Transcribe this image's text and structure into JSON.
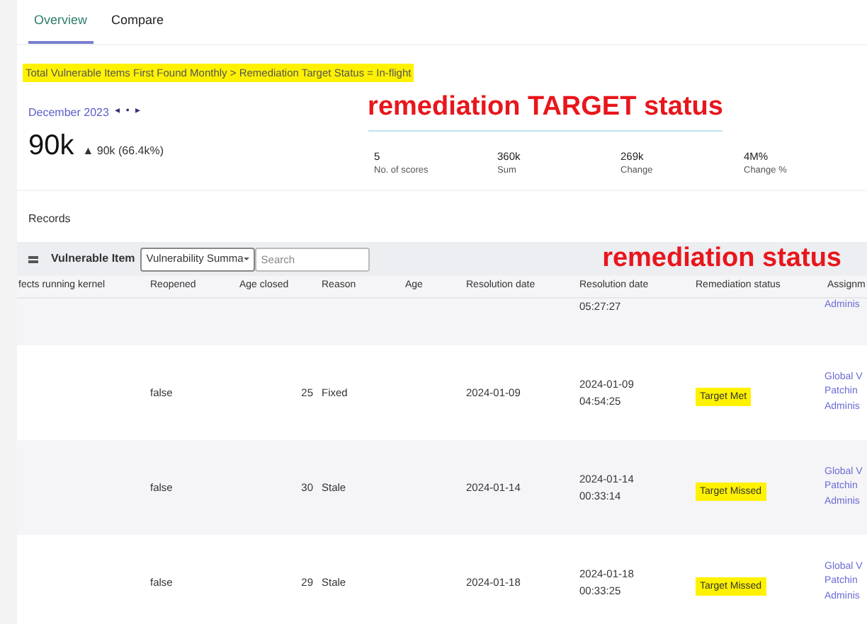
{
  "tabs": [
    {
      "label": "Overview",
      "selected": true
    },
    {
      "label": "Compare",
      "selected": false
    }
  ],
  "breadcrumb": {
    "text": "Total Vulnerable Items First Found Monthly > Remediation Target Status = In-flight",
    "highlighted": true
  },
  "period": {
    "label": "December 2023",
    "prev": "◂",
    "dot": "•",
    "next": "▸"
  },
  "kpi": {
    "value": "90k",
    "change": "▲ 90k (66.4k%)"
  },
  "stats": [
    {
      "value": "5",
      "label": "No. of scores"
    },
    {
      "value": "360k",
      "label": "Sum"
    },
    {
      "value": "269k",
      "label": "Change"
    },
    {
      "value": "4M%",
      "label": "Change %"
    }
  ],
  "annotations": [
    {
      "text": "remediation TARGET status",
      "underline": true
    },
    {
      "text": "remediation status",
      "underline": false
    }
  ],
  "records": {
    "title": "Records",
    "table_label": "Vulnerable Item",
    "select_value": "Vulnerability Summa",
    "search_placeholder": "Search"
  },
  "table": {
    "columns": [
      "fects running kernel",
      "Reopened",
      "Age closed",
      "Reason",
      "Age",
      "Resolution date",
      "Resolution date",
      "Remediation status",
      "Assignm"
    ],
    "partial_row": {
      "resolution_time": "05:27:27",
      "assignment": [
        "Adminis"
      ]
    },
    "rows": [
      {
        "reopened": "false",
        "age_closed": "25",
        "reason": "Fixed",
        "resolution_date": "2024-01-09",
        "resolution_datetime": [
          "2024-01-09",
          "04:54:25"
        ],
        "status": "Target Met",
        "highlighted": true,
        "assignment": [
          "Global V",
          "Patchin",
          "Adminis"
        ]
      },
      {
        "reopened": "false",
        "age_closed": "30",
        "reason": "Stale",
        "resolution_date": "2024-01-14",
        "resolution_datetime": [
          "2024-01-14",
          "00:33:14"
        ],
        "status": "Target Missed",
        "highlighted": true,
        "assignment": [
          "Global V",
          "Patchin",
          "Adminis"
        ]
      },
      {
        "reopened": "false",
        "age_closed": "29",
        "reason": "Stale",
        "resolution_date": "2024-01-18",
        "resolution_datetime": [
          "2024-01-18",
          "00:33:25"
        ],
        "status": "Target Missed",
        "highlighted": true,
        "assignment": [
          "Global V",
          "Patchin",
          "Adminis"
        ]
      }
    ]
  }
}
